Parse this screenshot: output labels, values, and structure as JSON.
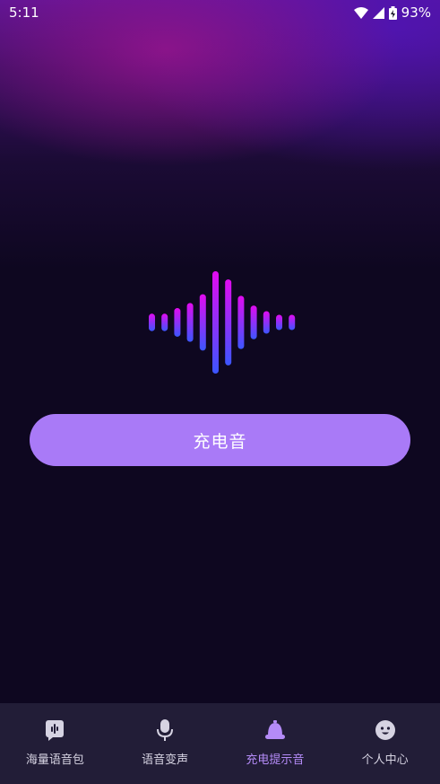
{
  "status_bar": {
    "time": "5:11",
    "battery": "93%"
  },
  "main": {
    "button_label": "充电音"
  },
  "waveform": {
    "levels": [
      0.17,
      0.17,
      0.28,
      0.38,
      0.55,
      1.0,
      0.84,
      0.52,
      0.33,
      0.22,
      0.15,
      0.15
    ],
    "gradient_top": "#e20bf0",
    "gradient_bottom": "#3b56ff"
  },
  "nav": {
    "items": [
      {
        "label": "海量语音包",
        "icon": "voice-pack-icon"
      },
      {
        "label": "语音变声",
        "icon": "microphone-icon"
      },
      {
        "label": "充电提示音",
        "icon": "bell-icon"
      },
      {
        "label": "个人中心",
        "icon": "smiley-face-icon"
      }
    ],
    "active_index": 2,
    "active_color": "#b48bf7",
    "inactive_color": "#d6d3e2"
  }
}
